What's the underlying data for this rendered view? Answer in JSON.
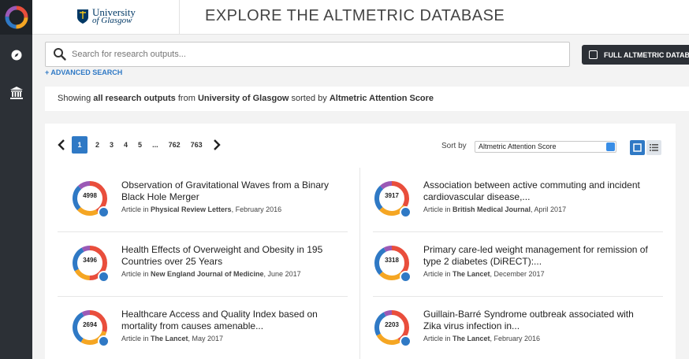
{
  "header": {
    "university_line1": "University",
    "university_line2": "of Glasgow",
    "title": "EXPLORE THE ALTMETRIC DATABASE"
  },
  "rail": {
    "items": [
      "altmetric-logo-icon",
      "compass-icon",
      "institution-icon"
    ]
  },
  "search": {
    "placeholder": "Search for research outputs...",
    "advanced_label": "+ ADVANCED SEARCH",
    "full_db_label": "FULL ALTMETRIC DATAB"
  },
  "summary": {
    "prefix": "Showing ",
    "scope": "all research outputs",
    "from": " from ",
    "institution": "University of Glasgow",
    "sorted": " sorted by ",
    "sort_field": "Altmetric Attention Score"
  },
  "pager": {
    "pages": [
      "1",
      "2",
      "3",
      "4",
      "5",
      "...",
      "762",
      "763"
    ],
    "active": "1"
  },
  "sort": {
    "label": "Sort by",
    "selected": "Altmetric Attention Score"
  },
  "results": [
    {
      "score": "4998",
      "title": "Observation of Gravitational Waves from a Binary Black Hole Merger",
      "type": "Article in ",
      "journal": "Physical Review Letters",
      "date": ", February 2016"
    },
    {
      "score": "3917",
      "title": "Association between active commuting and incident cardiovascular disease,...",
      "type": "Article in ",
      "journal": "British Medical Journal",
      "date": ", April 2017"
    },
    {
      "score": "3496",
      "title": "Health Effects of Overweight and Obesity in 195 Countries over 25 Years",
      "type": "Article in ",
      "journal": "New England Journal of Medicine",
      "date": ", June 2017"
    },
    {
      "score": "3318",
      "title": "Primary care-led weight management for remission of type 2 diabetes (DiRECT):...",
      "type": "Article in ",
      "journal": "The Lancet",
      "date": ", December 2017"
    },
    {
      "score": "2694",
      "title": "Healthcare Access and Quality Index based on mortality from causes amenable...",
      "type": "Article in ",
      "journal": "The Lancet",
      "date": ", May 2017"
    },
    {
      "score": "2203",
      "title": "Guillain-Barré Syndrome outbreak associated with Zika virus infection in...",
      "type": "Article in ",
      "journal": "The Lancet",
      "date": ", February 2016"
    }
  ],
  "colors": {
    "accent": "#2f79c5",
    "rail": "#2c3036",
    "rail_top": "#1f2328"
  }
}
